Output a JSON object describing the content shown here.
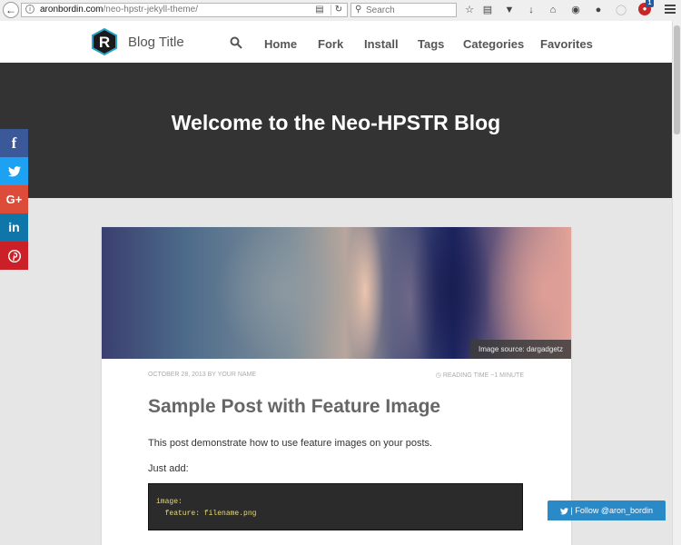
{
  "browser": {
    "url_host": "aronbordin.com",
    "url_path": "/neo-hpstr-jekyll-theme/",
    "search_placeholder": "Search",
    "addon_count": "1"
  },
  "nav": {
    "blog_title": "Blog Title",
    "links": [
      "Home",
      "Fork",
      "Install",
      "Tags",
      "Categories",
      "Favorites"
    ]
  },
  "hero": {
    "title": "Welcome to the Neo-HPSTR Blog"
  },
  "social": {
    "items": [
      {
        "icon": "facebook-icon",
        "glyph": "f",
        "color": "#3b5998"
      },
      {
        "icon": "twitter-icon",
        "glyph": "🐦",
        "color": "#1da1f2"
      },
      {
        "icon": "google-plus-icon",
        "glyph": "G+",
        "color": "#dd4b39"
      },
      {
        "icon": "linkedin-icon",
        "glyph": "in",
        "color": "#0e76a8"
      },
      {
        "icon": "pinterest-icon",
        "glyph": "℗",
        "color": "#cb2027"
      }
    ]
  },
  "post": {
    "image_credit": "Image source: dargadgetz",
    "meta_date": "October 28, 2013 by Your Name",
    "reading_time": "Reading time ~1 minute",
    "title": "Sample Post with Feature Image",
    "paragraph1": "This post demonstrate how to use feature images on your posts.",
    "paragraph2": "Just add:",
    "code": "image:\n  feature: filename.png"
  },
  "follow": {
    "label": "| Follow @aron_bordin"
  }
}
